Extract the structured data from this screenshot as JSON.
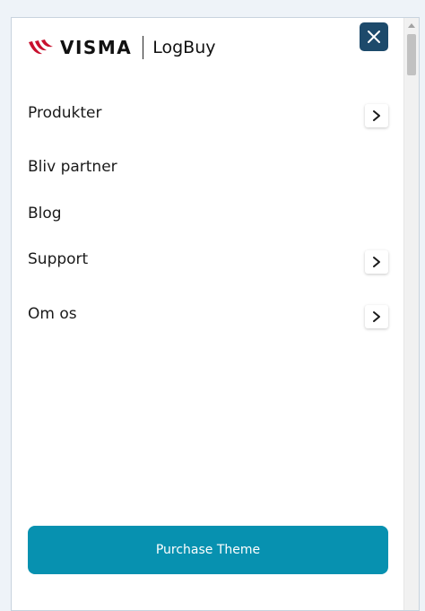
{
  "brand": {
    "logo_text": "VISMA",
    "product_name": "LogBuy",
    "logo_color": "#c8102e"
  },
  "menu": {
    "close_icon": "close-icon",
    "items": [
      {
        "label": "Produkter",
        "has_submenu": true
      },
      {
        "label": "Bliv partner",
        "has_submenu": false
      },
      {
        "label": "Blog",
        "has_submenu": false
      },
      {
        "label": "Support",
        "has_submenu": true
      },
      {
        "label": "Om os",
        "has_submenu": true
      }
    ]
  },
  "cta": {
    "label": "Purchase Theme",
    "color": "#0791b0"
  },
  "colors": {
    "close_button_bg": "#1d4a6b",
    "text": "#1a1a1a"
  }
}
